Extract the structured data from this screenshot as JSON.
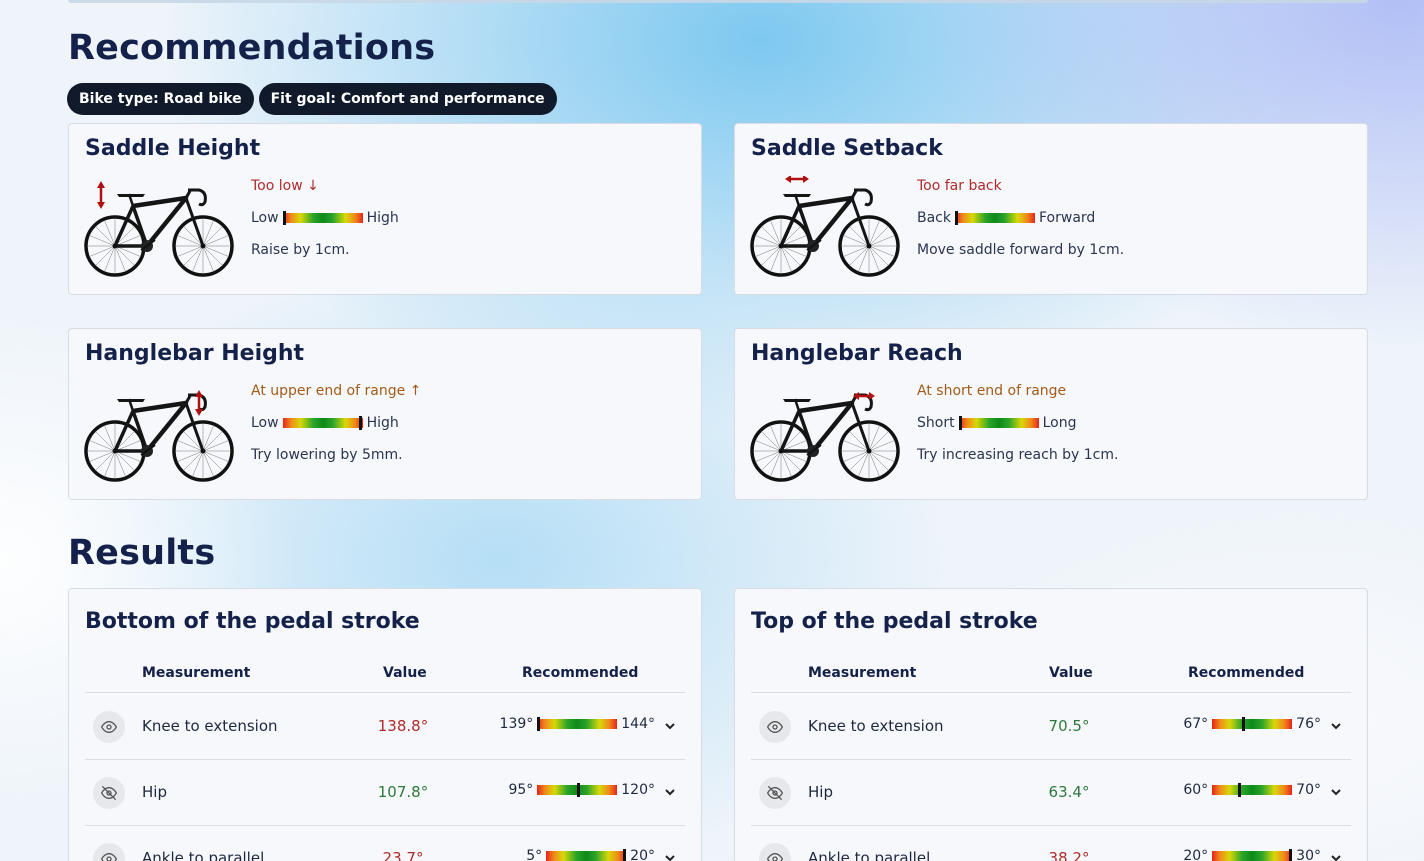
{
  "recommendations": {
    "title": "Recommendations",
    "pills": [
      "Bike type: Road bike",
      "Fit goal: Comfort and performance"
    ],
    "cards": [
      {
        "title": "Saddle Height",
        "status": "Too low ↓",
        "status_color": "#b02a2a",
        "low": "Low",
        "high": "High",
        "level": 0.0,
        "advice": "Raise by 1cm.",
        "arrow": "saddle-vertical"
      },
      {
        "title": "Saddle Setback",
        "status": "Too far back",
        "status_color": "#b02a2a",
        "low": "Back",
        "high": "Forward",
        "level": 0.0,
        "advice": "Move saddle forward by 1cm.",
        "arrow": "saddle-horizontal"
      },
      {
        "title": "Hanglebar Height",
        "status": "At upper end of range ↑",
        "status_color": "#a25b18",
        "low": "Low",
        "high": "High",
        "level": 0.98,
        "advice": "Try lowering by 5mm.",
        "arrow": "bar-vertical"
      },
      {
        "title": "Hanglebar Reach",
        "status": "At short end of range",
        "status_color": "#a25b18",
        "low": "Short",
        "high": "Long",
        "level": 0.02,
        "advice": "Try increasing reach by 1cm.",
        "arrow": "bar-horizontal"
      }
    ]
  },
  "results": {
    "title": "Results",
    "headers": {
      "measurement": "Measurement",
      "value": "Value",
      "recommended": "Recommended"
    },
    "tables": [
      {
        "title": "Bottom of the pedal stroke",
        "rows": [
          {
            "name": "Knee to extension",
            "value": "138.8°",
            "status": "bad",
            "min": "139°",
            "max": "144°",
            "level": 0.0,
            "icon": "eye-icon"
          },
          {
            "name": "Hip",
            "value": "107.8°",
            "status": "good",
            "min": "95°",
            "max": "120°",
            "level": 0.51,
            "icon": "eye-off-icon"
          },
          {
            "name": "Ankle to parallel",
            "value": "23.7°",
            "status": "bad",
            "min": "5°",
            "max": "20°",
            "level": 1.0,
            "icon": "eye-icon"
          }
        ]
      },
      {
        "title": "Top of the pedal stroke",
        "rows": [
          {
            "name": "Knee to extension",
            "value": "70.5°",
            "status": "good",
            "min": "67°",
            "max": "76°",
            "level": 0.39,
            "icon": "eye-icon"
          },
          {
            "name": "Hip",
            "value": "63.4°",
            "status": "good",
            "min": "60°",
            "max": "70°",
            "level": 0.34,
            "icon": "eye-off-icon"
          },
          {
            "name": "Ankle to parallel",
            "value": "38.2°",
            "status": "bad",
            "min": "20°",
            "max": "30°",
            "level": 1.0,
            "icon": "eye-icon"
          }
        ]
      }
    ]
  },
  "colors": {
    "good": "#2c7a3a",
    "bad": "#b02a2a",
    "warn": "#a25b18",
    "arrow": "#b01010"
  }
}
